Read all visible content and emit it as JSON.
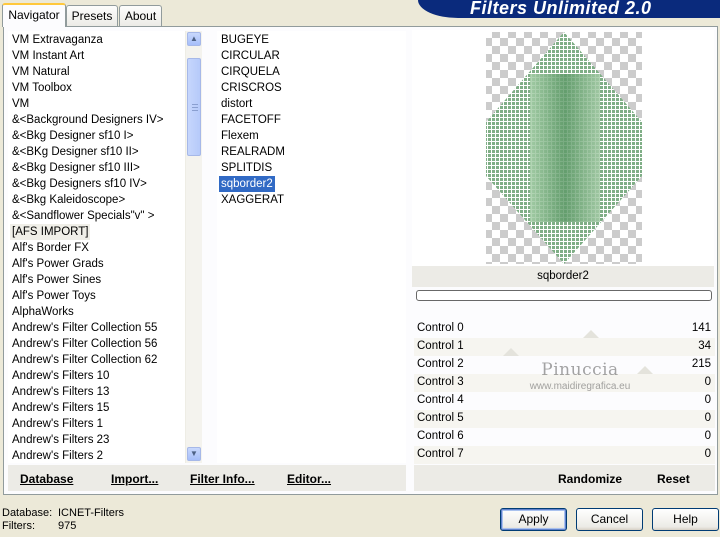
{
  "tabs": [
    {
      "label": "Navigator",
      "active": true
    },
    {
      "label": "Presets",
      "active": false
    },
    {
      "label": "About",
      "active": false
    }
  ],
  "app_title": "Filters Unlimited 2.0",
  "categories": [
    "VM Extravaganza",
    "VM Instant Art",
    "VM Natural",
    "VM Toolbox",
    "VM",
    "&<Background Designers IV>",
    "&<Bkg Designer sf10 I>",
    "&<BKg Designer sf10 II>",
    "&<Bkg Designer sf10 III>",
    "&<Bkg Designers sf10 IV>",
    "&<Bkg Kaleidoscope>",
    "&<Sandflower Specials\"v\" >",
    "[AFS IMPORT]",
    "Alf's Border FX",
    "Alf's Power Grads",
    "Alf's Power Sines",
    "Alf's Power Toys",
    "AlphaWorks",
    "Andrew's Filter Collection 55",
    "Andrew's Filter Collection 56",
    "Andrew's Filter Collection 62",
    "Andrew's Filters 10",
    "Andrew's Filters 13",
    "Andrew's Filters 15",
    "Andrew's Filters 1",
    "Andrew's Filters 23",
    "Andrew's Filters 2"
  ],
  "selected_category": "[AFS IMPORT]",
  "filters": [
    "BUGEYE",
    "CIRCULAR",
    "CIRQUELA",
    "CRISCROS",
    "distort",
    "FACETOFF",
    "Flexem",
    "REALRADM",
    "SPLITDIS",
    "sqborder2",
    "XAGGERAT"
  ],
  "selected_filter": "sqborder2",
  "preview_label": "sqborder2",
  "watermark": {
    "name": "Pinuccia",
    "url": "www.maidiregrafica.eu"
  },
  "controls": [
    {
      "label": "Control 0",
      "value": "141",
      "level": 0.553
    },
    {
      "label": "Control 1",
      "value": "34",
      "level": 0.133
    },
    {
      "label": "Control 2",
      "value": "215",
      "level": 0.843
    },
    {
      "label": "Control 3",
      "value": "0",
      "level": 0
    },
    {
      "label": "Control 4",
      "value": "0",
      "level": 0
    },
    {
      "label": "Control 5",
      "value": "0",
      "level": 0
    },
    {
      "label": "Control 6",
      "value": "0",
      "level": 0
    },
    {
      "label": "Control 7",
      "value": "0",
      "level": 0
    }
  ],
  "left_buttons": {
    "database": "Database",
    "import": "Import...",
    "filter_info": "Filter Info...",
    "editor": "Editor..."
  },
  "right_buttons": {
    "randomize": "Randomize",
    "reset": "Reset"
  },
  "status": {
    "database_label": "Database:",
    "database_value": "ICNET-Filters",
    "filters_label": "Filters:",
    "filters_value": "975"
  },
  "dialog_buttons": {
    "apply": "Apply",
    "cancel": "Cancel",
    "help": "Help"
  },
  "colors": {
    "selection_blue": "#316ac5",
    "banner_navy": "#0a2a7c",
    "preview_green": "#7fae86"
  }
}
